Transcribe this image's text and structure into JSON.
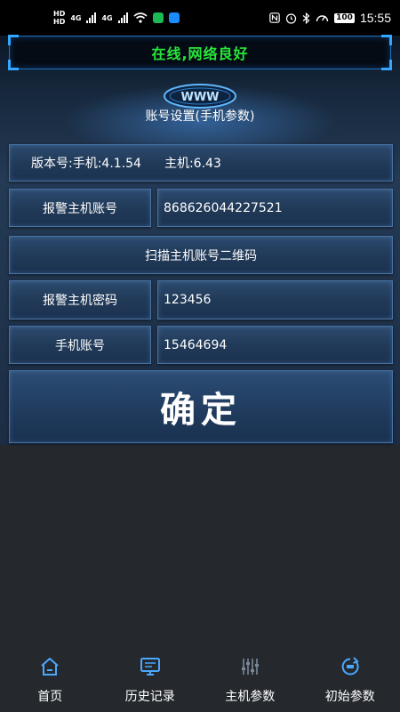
{
  "status_bar": {
    "sim_tags": [
      "HD",
      "HD"
    ],
    "network_types": [
      "4G",
      "4G"
    ],
    "battery": "100",
    "time": "15:55"
  },
  "banner": {
    "network_status": "在线,网络良好",
    "status_color": "#27e63a"
  },
  "header": {
    "logo_text": "WWW",
    "title": "账号设置(手机参数)"
  },
  "form": {
    "version_label": "版本号:手机:4.1.54",
    "host_version_label": "主机:6.43",
    "alarm_host_account_label": "报警主机账号",
    "alarm_host_account_value": "868626044227521",
    "scan_qr_button": "扫描主机账号二维码",
    "alarm_host_password_label": "报警主机密码",
    "alarm_host_password_value": "123456",
    "phone_account_label": "手机账号",
    "phone_account_value": "15464694",
    "confirm_button": "确定"
  },
  "bottom_nav": {
    "items": [
      {
        "label": "首页",
        "icon": "home-icon"
      },
      {
        "label": "历史记录",
        "icon": "monitor-icon"
      },
      {
        "label": "主机参数",
        "icon": "sliders-icon"
      },
      {
        "label": "初始参数",
        "icon": "reset-icon"
      }
    ]
  },
  "colors": {
    "accent": "#4aa8ff",
    "background": "#25292e"
  }
}
